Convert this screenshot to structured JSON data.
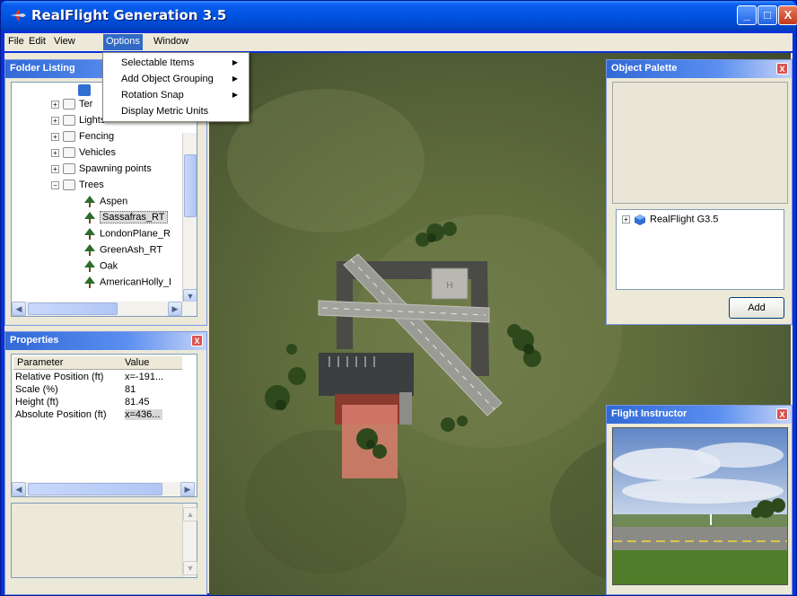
{
  "window": {
    "title": "RealFlight Generation 3.5",
    "controls": {
      "minimize": "_",
      "maximize": "□",
      "close": "X"
    }
  },
  "menubar": {
    "items": [
      {
        "label": "File"
      },
      {
        "label": "Edit"
      },
      {
        "label": "View"
      },
      {
        "label": "Options"
      },
      {
        "label": "Window"
      }
    ]
  },
  "options_menu": {
    "items": [
      {
        "label": "Selectable Items",
        "submenu_arrow": "▶"
      },
      {
        "label": "Add Object Grouping",
        "submenu_arrow": "▶"
      },
      {
        "label": "Rotation Snap",
        "submenu_arrow": "▶"
      },
      {
        "label": "Display Metric Units"
      }
    ]
  },
  "folder_listing": {
    "title": "Folder Listing",
    "items": [
      {
        "label": "Ter",
        "type": "folder",
        "expander": "+"
      },
      {
        "label": "Lights",
        "type": "folder",
        "expander": "+"
      },
      {
        "label": "Fencing",
        "type": "folder",
        "expander": "+"
      },
      {
        "label": "Vehicles",
        "type": "folder",
        "expander": "+"
      },
      {
        "label": "Spawning points",
        "type": "folder",
        "expander": "+"
      },
      {
        "label": "Trees",
        "type": "folder",
        "expander": "−"
      },
      {
        "label": "Aspen",
        "type": "tree"
      },
      {
        "label": "Sassafras_RT",
        "type": "tree",
        "selected": true
      },
      {
        "label": "LondonPlane_R",
        "type": "tree"
      },
      {
        "label": "GreenAsh_RT",
        "type": "tree"
      },
      {
        "label": "Oak",
        "type": "tree"
      },
      {
        "label": "AmericanHolly_I",
        "type": "tree"
      }
    ]
  },
  "properties": {
    "title": "Properties",
    "close": "X",
    "columns": [
      "Parameter",
      "Value"
    ],
    "rows": [
      {
        "parameter": "Relative Position (ft)",
        "value": "x=-191..."
      },
      {
        "parameter": "Scale (%)",
        "value": "81"
      },
      {
        "parameter": "Height (ft)",
        "value": "81.45"
      },
      {
        "parameter": "Absolute Position (ft)",
        "value": "x=436...",
        "selected": true
      }
    ]
  },
  "object_palette": {
    "title": "Object Palette",
    "close": "X",
    "tree": [
      {
        "label": "RealFlight  G3.5",
        "expander": "+"
      }
    ],
    "add_button": "Add"
  },
  "flight_instructor": {
    "title": "Flight Instructor",
    "close": "X"
  },
  "colors": {
    "titlebar": "#0053e1",
    "menu_highlight": "#316ac5",
    "panel_header": "#3169d6",
    "grass": "#5f6c3c",
    "runway": "#9b9b95"
  }
}
